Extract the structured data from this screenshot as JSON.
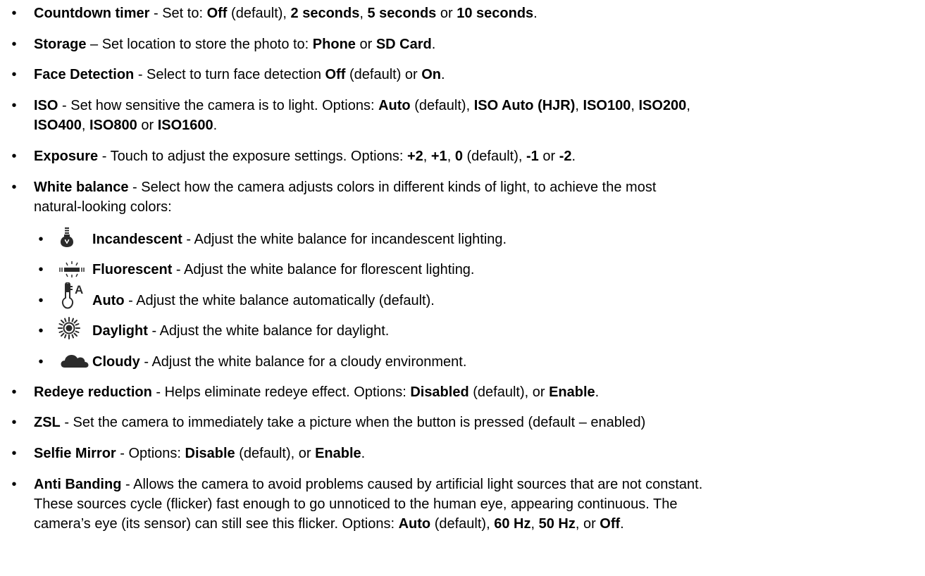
{
  "items": [
    {
      "name": "countdown-timer",
      "label": "Countdown timer",
      "segments": [
        " - Set to: ",
        "Off",
        " (default), ",
        "2 seconds",
        ", ",
        "5 seconds",
        " or ",
        "10 seconds",
        "."
      ]
    },
    {
      "name": "storage",
      "label": "Storage",
      "segments": [
        " – Set location to store the photo to: ",
        "Phone",
        " or ",
        "SD Card",
        "."
      ]
    },
    {
      "name": "face-detection",
      "label": "Face Detection",
      "segments": [
        " - Select to turn face detection ",
        "Off",
        " (default) or ",
        "On",
        "."
      ]
    },
    {
      "name": "iso",
      "label": "ISO",
      "line1": [
        " - Set how sensitive the camera is to light. Options: ",
        "Auto",
        " (default), ",
        "ISO Auto (HJR)",
        ", ",
        "ISO100",
        ", ",
        "ISO200",
        ","
      ],
      "line2": [
        "ISO400",
        ", ",
        "ISO800",
        " or ",
        "ISO1600",
        "."
      ]
    },
    {
      "name": "exposure",
      "label": "Exposure",
      "segments": [
        " - Touch to adjust the exposure settings. Options: ",
        "+2",
        ", ",
        "+1",
        ", ",
        "0",
        " (default), ",
        "-1",
        " or ",
        "-2",
        "."
      ]
    },
    {
      "name": "white-balance",
      "label": "White balance",
      "line1": " - Select how the camera adjusts colors in different kinds of light, to achieve the most",
      "line2": "natural-looking colors:"
    }
  ],
  "white_balance_options": [
    {
      "name": "incandescent",
      "icon": "incandescent-bulb-icon",
      "label": "Incandescent",
      "desc": " - Adjust the white balance for incandescent lighting."
    },
    {
      "name": "fluorescent",
      "icon": "fluorescent-tube-icon",
      "label": "Fluorescent",
      "desc": " - Adjust the white balance for florescent lighting."
    },
    {
      "name": "auto",
      "icon": "auto-white-balance-icon",
      "label": "Auto",
      "desc": " - Adjust the white balance automatically (default)."
    },
    {
      "name": "daylight",
      "icon": "sun-icon",
      "label": "Daylight",
      "desc": " - Adjust the white balance for daylight."
    },
    {
      "name": "cloudy",
      "icon": "cloud-icon",
      "label": "Cloudy",
      "desc": " - Adjust the white balance for a cloudy environment."
    }
  ],
  "items_after": [
    {
      "name": "redeye-reduction",
      "label": "Redeye reduction",
      "segments": [
        " - Helps eliminate redeye effect. Options: ",
        "Disabled",
        " (default), or ",
        "Enable",
        "."
      ]
    },
    {
      "name": "zsl",
      "label": "ZSL",
      "segments": [
        " - Set the camera to immediately take a picture when the button is pressed (default – enabled)"
      ]
    },
    {
      "name": "selfie-mirror",
      "label": "Selfie Mirror",
      "segments": [
        " - Options: ",
        "Disable",
        " (default), or ",
        "Enable",
        "."
      ]
    },
    {
      "name": "anti-banding",
      "label": "Anti Banding",
      "line1": " - Allows the camera to avoid problems caused by artificial light sources that are not constant.",
      "line2": "These sources cycle (flicker) fast enough to go unnoticed to the human eye, appearing continuous. The",
      "line3": [
        "camera’s eye (its sensor) can still see this flicker. Options: ",
        "Auto",
        " (default), ",
        "60 Hz",
        ", ",
        "50 Hz",
        ", or ",
        "Off",
        "."
      ]
    }
  ],
  "bullet_char": "•",
  "colors": {
    "text": "#000000",
    "icon": "#2b2b2b"
  }
}
